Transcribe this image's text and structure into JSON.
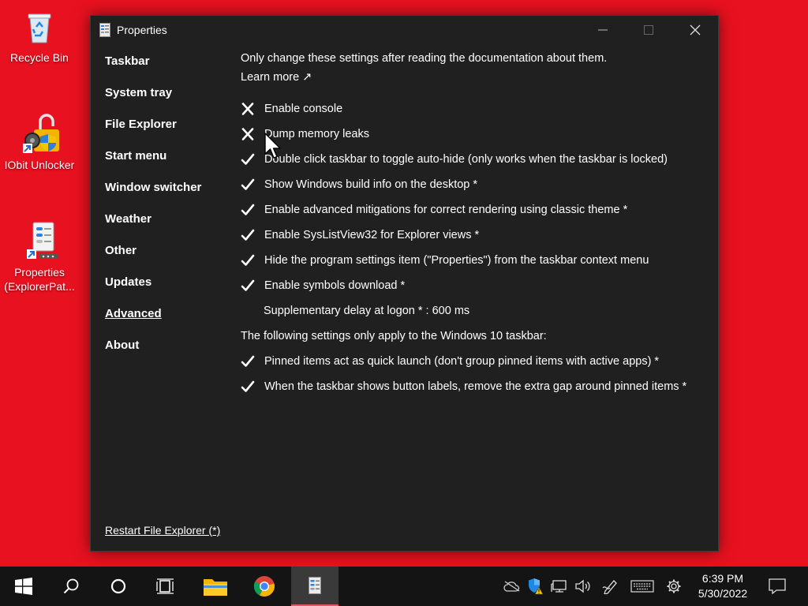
{
  "desktop": {
    "icons": [
      {
        "label": "Recycle Bin"
      },
      {
        "label": "IObit Unlocker"
      },
      {
        "label": "Properties\n(ExplorerPat..."
      }
    ]
  },
  "window": {
    "title": "Properties",
    "nav": [
      {
        "label": "Taskbar"
      },
      {
        "label": "System tray"
      },
      {
        "label": "File Explorer"
      },
      {
        "label": "Start menu"
      },
      {
        "label": "Window switcher"
      },
      {
        "label": "Weather"
      },
      {
        "label": "Other"
      },
      {
        "label": "Updates"
      },
      {
        "label": "Advanced",
        "selected": true
      },
      {
        "label": "About"
      }
    ],
    "restart_label": "Restart File Explorer (*)",
    "content": {
      "intro": "Only change these settings after reading the documentation about them.",
      "learn_more": "Learn more ↗",
      "settings": [
        {
          "label": "Enable console",
          "checked": false
        },
        {
          "label": "Dump memory leaks",
          "checked": false
        },
        {
          "label": "Double click taskbar to toggle auto-hide (only works when the taskbar is locked)",
          "checked": true
        },
        {
          "label": "Show Windows build info on the desktop *",
          "checked": true
        },
        {
          "label": "Enable advanced mitigations for correct rendering using classic theme *",
          "checked": true
        },
        {
          "label": "Enable SysListView32 for Explorer views *",
          "checked": true
        },
        {
          "label": "Hide the program settings item (\"Properties\") from the taskbar context menu",
          "checked": true
        },
        {
          "label": "Enable symbols download *",
          "checked": true
        }
      ],
      "delay_label": "Supplementary delay at logon * : 600 ms",
      "section_win10": "The following settings only apply to the Windows 10 taskbar:",
      "settings_win10": [
        {
          "label": "Pinned items act as quick launch (don't group pinned items with active apps) *",
          "checked": true
        },
        {
          "label": "When the taskbar shows button labels, remove the extra gap around pinned items *",
          "checked": true
        }
      ]
    }
  },
  "taskbar": {
    "clock_time": "6:39 PM",
    "clock_date": "5/30/2022"
  },
  "colors": {
    "desktop_bg": "#e8111f",
    "window_bg": "#202020",
    "taskbar_bg": "#141414"
  }
}
